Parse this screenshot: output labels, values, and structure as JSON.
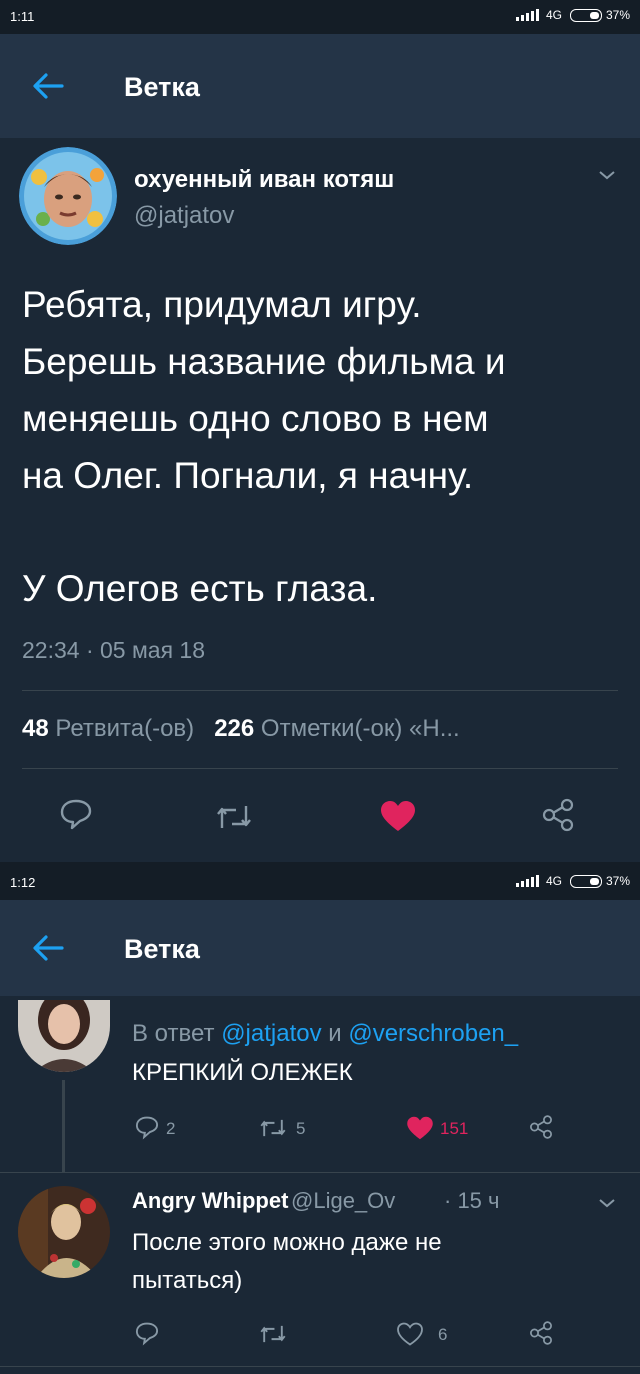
{
  "screen1": {
    "status": {
      "time": "1:11",
      "network": "4G",
      "battery": "37%"
    },
    "header": {
      "title": "Ветка"
    },
    "tweet": {
      "author_name": "охуенный иван котяш",
      "author_handle": "@jatjatov",
      "text_para1": "Ребята, придумал игру.\nБерешь название фильма и\nменяешь одно слово в нем\nна Олег. Погнали, я начну.",
      "text_para2": "У Олегов есть глаза.",
      "timestamp": "22:34 · 05 мая 18",
      "retweets_count": "48",
      "retweets_label": "Ретвита(-ов)",
      "likes_count": "226",
      "likes_label": "Отметки(-ок)",
      "more_label": "«Н...",
      "liked": true
    }
  },
  "screen2": {
    "status": {
      "time": "1:12",
      "network": "4G",
      "battery": "37%"
    },
    "header": {
      "title": "Ветка"
    },
    "reply1": {
      "reply_prefix": "В ответ",
      "mention1": "@jatjatov",
      "conj": "и",
      "mention2": "@verschroben_",
      "text": "КРЕПКИЙ ОЛЕЖЕК",
      "replies": "2",
      "retweets": "5",
      "likes": "151",
      "liked": true
    },
    "reply2": {
      "author_name": "Angry Whippet",
      "author_handle": "@Lige_Ov",
      "time": "· 15 ч",
      "text": "После этого можно даже не\nпытаться)",
      "likes": "6",
      "liked": false
    }
  },
  "colors": {
    "background": "#1b2836",
    "header": "#243447",
    "link": "#1da1f2",
    "like": "#e0245e",
    "muted": "#8899a6"
  },
  "icons": [
    "back-arrow-icon",
    "chevron-down-icon",
    "reply-icon",
    "retweet-icon",
    "heart-icon",
    "share-icon",
    "signal-icon",
    "battery-icon"
  ]
}
